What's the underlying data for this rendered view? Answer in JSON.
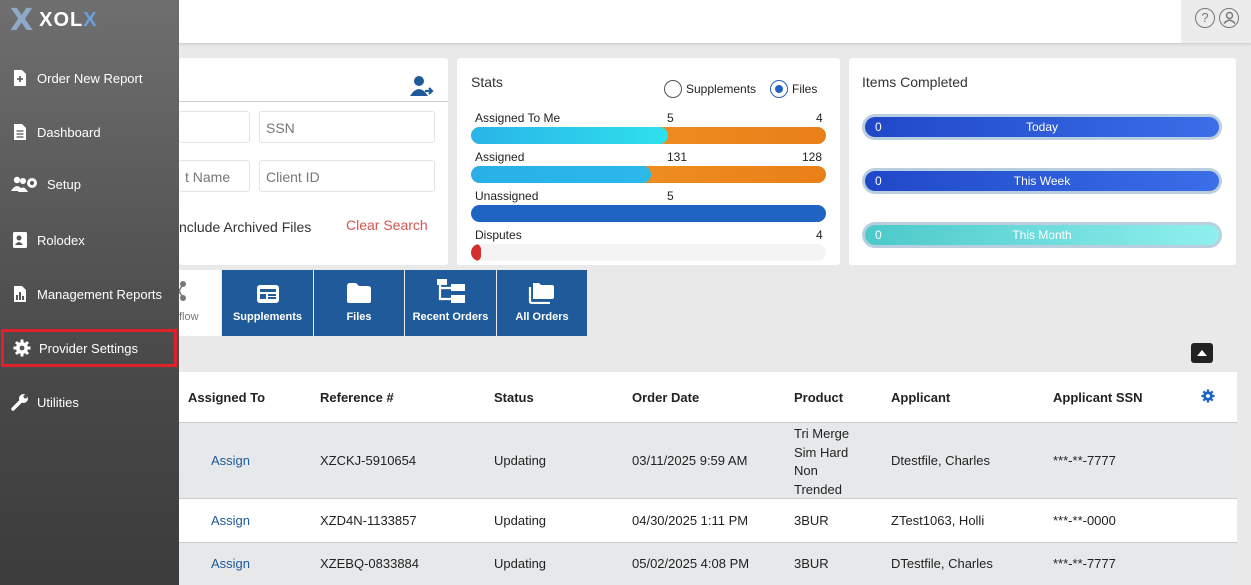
{
  "app": {
    "logo_text": "XOL",
    "logo_accent": "X"
  },
  "header": {
    "help_icon": "help-circle-icon",
    "user_icon": "user-circle-icon"
  },
  "sidebar": {
    "items": [
      {
        "label": "Order New Report",
        "icon": "file-plus-icon"
      },
      {
        "label": "Dashboard",
        "icon": "document-icon"
      },
      {
        "label": "Setup",
        "icon": "users-gear-icon"
      },
      {
        "label": "Rolodex",
        "icon": "contact-card-icon"
      },
      {
        "label": "Management Reports",
        "icon": "report-chart-icon"
      },
      {
        "label": "Provider Settings",
        "icon": "gear-icon",
        "selected": true
      },
      {
        "label": "Utilities",
        "icon": "wrench-icon"
      }
    ]
  },
  "search": {
    "ssn_placeholder": "SSN",
    "name_placeholder_partial": "t Name",
    "client_id_placeholder": "Client ID",
    "archived_label": "nclude Archived Files",
    "clear_label": "Clear Search"
  },
  "stats": {
    "title": "Stats",
    "radio_supplements": "Supplements",
    "radio_files": "Files",
    "rows": [
      {
        "label": "Assigned To Me",
        "mid": "5",
        "right": "4"
      },
      {
        "label": "Assigned",
        "mid": "131",
        "right": "128"
      },
      {
        "label": "Unassigned",
        "mid": "5",
        "right": ""
      },
      {
        "label": "Disputes",
        "mid": "",
        "right": "4"
      }
    ]
  },
  "completed": {
    "title": "Items Completed",
    "items": [
      {
        "count": "0",
        "label": "Today"
      },
      {
        "count": "0",
        "label": "This Week"
      },
      {
        "count": "0",
        "label": "This Month"
      }
    ]
  },
  "tabs": [
    {
      "label": "flow",
      "icon": "workflow-icon"
    },
    {
      "label": "Supplements",
      "icon": "supplements-icon"
    },
    {
      "label": "Files",
      "icon": "folder-icon"
    },
    {
      "label": "Recent Orders",
      "icon": "sitemap-icon"
    },
    {
      "label": "All Orders",
      "icon": "folders-icon"
    }
  ],
  "table": {
    "columns": [
      "Assigned To",
      "Reference #",
      "Status",
      "Order Date",
      "Product",
      "Applicant",
      "Applicant SSN"
    ],
    "rows": [
      {
        "assigned": "Assign",
        "ref": "XZCKJ-5910654",
        "status": "Updating",
        "date": "03/11/2025 9:59 AM",
        "product": [
          "Tri Merge",
          "Sim Hard",
          "Non",
          "Trended"
        ],
        "applicant": "Dtestfile, Charles",
        "ssn": "***-**-7777"
      },
      {
        "assigned": "Assign",
        "ref": "XZD4N-1133857",
        "status": "Updating",
        "date": "04/30/2025 1:11 PM",
        "product": [
          "3BUR"
        ],
        "applicant": "ZTest1063, Holli",
        "ssn": "***-**-0000"
      },
      {
        "assigned": "Assign",
        "ref": "XZEBQ-0833884",
        "status": "Updating",
        "date": "05/02/2025 4:08 PM",
        "product": [
          "3BUR"
        ],
        "applicant": "DTestfile, Charles",
        "ssn": "***-**-7777"
      }
    ]
  },
  "colors": {
    "primary": "#1f5a9a",
    "sidebar": "#555555",
    "danger": "#d9534f",
    "orange": "#f08a1c",
    "cyan": "#29d0e8"
  }
}
